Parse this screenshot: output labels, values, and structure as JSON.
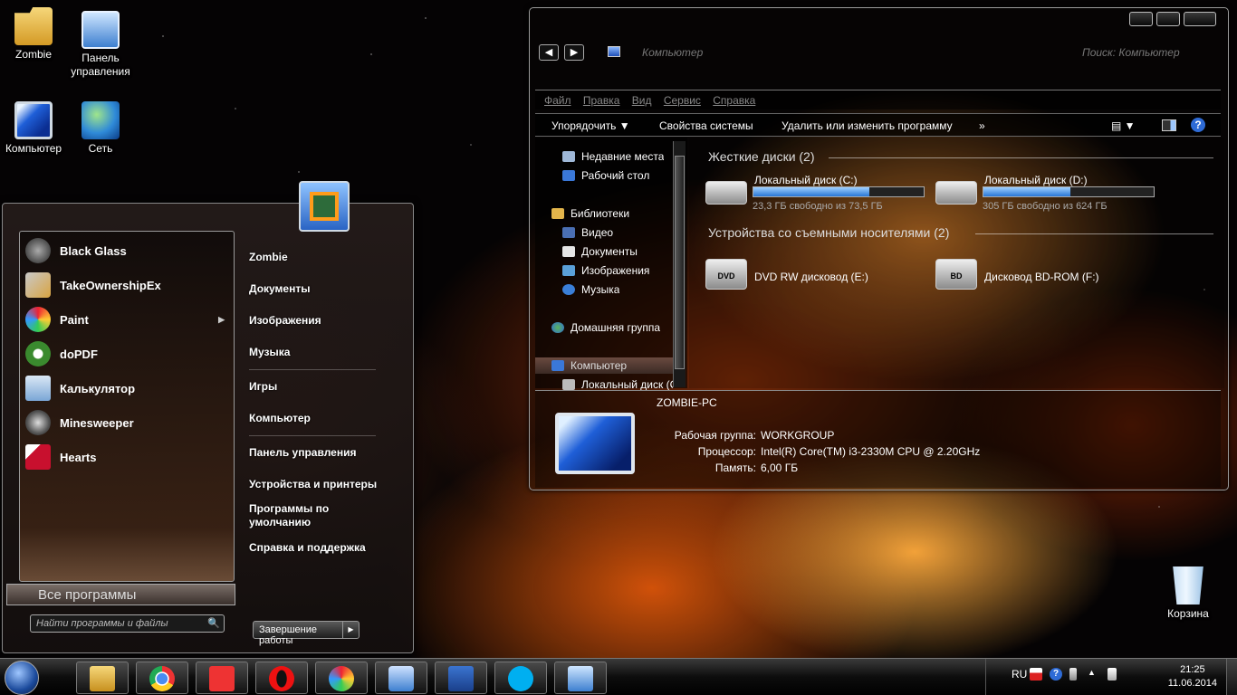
{
  "desktop": {
    "icons": [
      {
        "label": "Zombie"
      },
      {
        "label": "Панель\nуправления"
      },
      {
        "label": "Компьютер"
      },
      {
        "label": "Сеть"
      },
      {
        "label": "Корзина"
      }
    ]
  },
  "start_menu": {
    "programs": [
      {
        "label": "Black Glass"
      },
      {
        "label": "TakeOwnershipEx"
      },
      {
        "label": "Paint"
      },
      {
        "label": "doPDF"
      },
      {
        "label": "Калькулятор"
      },
      {
        "label": "Minesweeper"
      },
      {
        "label": "Hearts"
      }
    ],
    "submenu_arrow": "▶",
    "all_programs": "Все программы",
    "search_placeholder": "Найти программы и файлы",
    "search_icon": "🔍",
    "right_links": [
      {
        "label": "Zombie"
      },
      {
        "label": "Документы"
      },
      {
        "label": "Изображения"
      },
      {
        "label": "Музыка"
      },
      {
        "label": "Игры"
      },
      {
        "label": "Компьютер"
      },
      {
        "label": "Панель управления"
      },
      {
        "label": "Устройства и принтеры"
      },
      {
        "label": "Программы по умолчанию"
      },
      {
        "label": "Справка и поддержка"
      }
    ],
    "shutdown": "Завершение работы",
    "shutdown_arrow": "▶"
  },
  "explorer": {
    "nav_back": "◀",
    "nav_forward": "▶",
    "address": "Компьютер",
    "search_placeholder": "Поиск: Компьютер",
    "menu": [
      "Файл",
      "Правка",
      "Вид",
      "Сервис",
      "Справка"
    ],
    "toolbar": {
      "organize": "Упорядочить ▼",
      "system_properties": "Свойства системы",
      "uninstall": "Удалить или изменить программу",
      "more": "»",
      "view_icon": "▤ ▼",
      "help": "?"
    },
    "nav_items": [
      {
        "label": "Недавние места"
      },
      {
        "label": "Рабочий стол"
      },
      {
        "label": "Библиотеки"
      },
      {
        "label": "Видео"
      },
      {
        "label": "Документы"
      },
      {
        "label": "Изображения"
      },
      {
        "label": "Музыка"
      },
      {
        "label": "Домашняя группа"
      },
      {
        "label": "Компьютер"
      },
      {
        "label": "Локальный диск (C:)"
      }
    ],
    "groups": {
      "hdd": "Жесткие диски (2)",
      "removable": "Устройства со съемными носителями (2)"
    },
    "drives": [
      {
        "name": "Локальный диск (C:)",
        "free": "23,3 ГБ свободно из 73,5 ГБ",
        "used_fraction": 0.68
      },
      {
        "name": "Локальный диск (D:)",
        "free": "305 ГБ свободно из 624 ГБ",
        "used_fraction": 0.51
      }
    ],
    "removable": [
      {
        "name": "DVD RW дисковод (E:)",
        "badge": "DVD"
      },
      {
        "name": "Дисковод BD-ROM (F:)",
        "badge": "BD"
      }
    ],
    "details": {
      "pc_name": "ZOMBIE-PC",
      "workgroup_label": "Рабочая группа:",
      "workgroup": "WORKGROUP",
      "cpu_label": "Процессор:",
      "cpu": "Intel(R) Core(TM) i3-2330M CPU @ 2.20GHz",
      "ram_label": "Память:",
      "ram": "6,00 ГБ"
    }
  },
  "taskbar": {
    "language": "RU",
    "time": "21:25",
    "date": "11.06.2014",
    "help": "?",
    "tray_arrow": "▲"
  }
}
